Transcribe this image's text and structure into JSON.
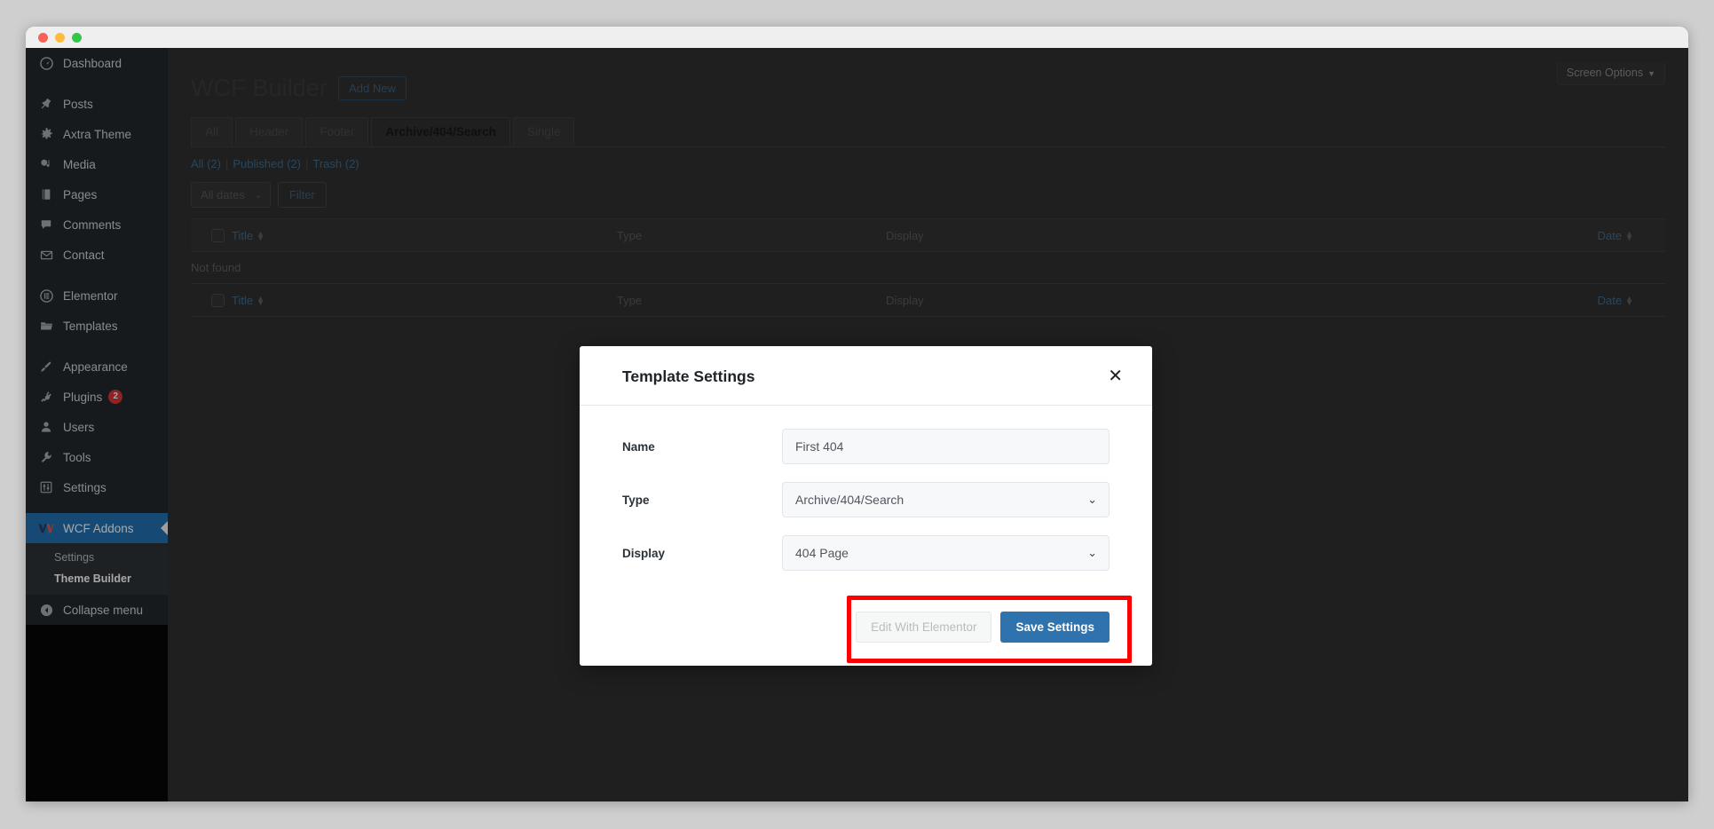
{
  "window": {
    "traffic_lights": [
      "close",
      "minimize",
      "maximize"
    ]
  },
  "sidebar": {
    "items": [
      {
        "label": "Dashboard",
        "icon": "dashboard-icon",
        "gap_after": true
      },
      {
        "label": "Posts",
        "icon": "pin-icon"
      },
      {
        "label": "Axtra Theme",
        "icon": "gear-icon"
      },
      {
        "label": "Media",
        "icon": "media-icon"
      },
      {
        "label": "Pages",
        "icon": "pages-icon"
      },
      {
        "label": "Comments",
        "icon": "comment-icon"
      },
      {
        "label": "Contact",
        "icon": "mail-icon",
        "gap_after": true
      },
      {
        "label": "Elementor",
        "icon": "elementor-icon"
      },
      {
        "label": "Templates",
        "icon": "folder-icon",
        "gap_after": true
      },
      {
        "label": "Appearance",
        "icon": "brush-icon"
      },
      {
        "label": "Plugins",
        "icon": "plug-icon",
        "badge": "2"
      },
      {
        "label": "Users",
        "icon": "user-icon"
      },
      {
        "label": "Tools",
        "icon": "wrench-icon"
      },
      {
        "label": "Settings",
        "icon": "sliders-icon",
        "gap_after": true
      },
      {
        "label": "WCF Addons",
        "icon": "wcf-logo-icon",
        "active": true
      }
    ],
    "submenu": [
      {
        "label": "Settings",
        "current": false
      },
      {
        "label": "Theme Builder",
        "current": true
      }
    ],
    "collapse": {
      "label": "Collapse menu",
      "icon": "collapse-arrow-icon"
    }
  },
  "header": {
    "screen_options_label": "Screen Options",
    "screen_options_caret": "▼"
  },
  "main": {
    "page_title": "WCF Builder",
    "add_new_label": "Add New",
    "tabs": [
      {
        "label": "All",
        "active": false
      },
      {
        "label": "Header",
        "active": false
      },
      {
        "label": "Footer",
        "active": false
      },
      {
        "label": "Archive/404/Search",
        "active": true
      },
      {
        "label": "Single",
        "active": false
      }
    ],
    "status_links": [
      {
        "label": "All",
        "count": "(2)"
      },
      {
        "label": "Published",
        "count": "(2)"
      },
      {
        "label": "Trash",
        "count": "(2)"
      }
    ],
    "status_separator": "|",
    "filters": {
      "dates_value": "All dates",
      "dates_chevron": "⌄",
      "filter_button": "Filter"
    },
    "table": {
      "columns": [
        "Title",
        "Type",
        "Display",
        "Date"
      ],
      "empty_message": "Not found",
      "sort_up": "▲",
      "sort_down": "▼"
    }
  },
  "modal": {
    "title": "Template Settings",
    "close_icon": "✕",
    "fields": [
      {
        "label": "Name",
        "value": "First 404",
        "type": "text",
        "placeholder": "Name"
      },
      {
        "label": "Type",
        "value": "Archive/404/Search",
        "type": "select"
      },
      {
        "label": "Display",
        "value": "404 Page",
        "type": "select"
      }
    ],
    "chevron": "⌄",
    "buttons": {
      "edit_elementor": "Edit With Elementor",
      "save_settings": "Save Settings"
    },
    "highlight_color": "#ff0000"
  },
  "colors": {
    "accent_blue": "#2271b1",
    "save_button": "#2e73ad",
    "badge_red": "#d63638",
    "sidebar_bg": "#23282d"
  }
}
